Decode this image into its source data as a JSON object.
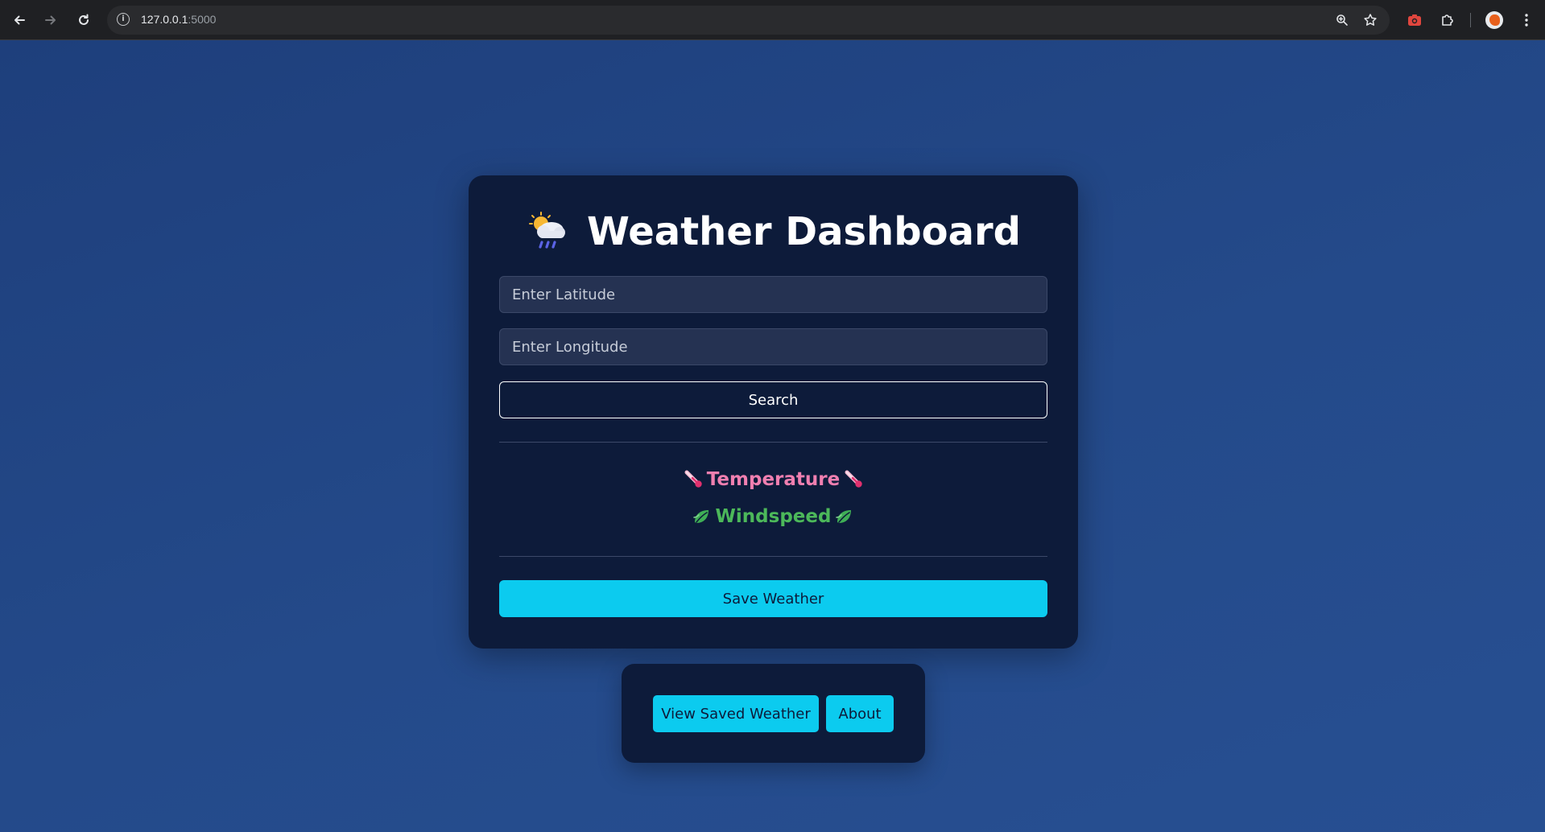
{
  "browser": {
    "url_host": "127.0.0.1",
    "url_port": ":5000",
    "icons": {
      "back": "arrow-left-icon",
      "forward": "arrow-right-icon",
      "reload": "reload-icon",
      "site_info": "info-icon",
      "zoom": "zoom-icon",
      "bookmark": "star-icon",
      "screenshot_ext": "camera-icon",
      "extensions": "puzzle-icon",
      "profile": "avatar",
      "menu": "kebab-menu-icon"
    }
  },
  "dashboard": {
    "title": "Weather Dashboard",
    "title_icon": "cloud-sun-rain-icon",
    "latitude_placeholder": "Enter Latitude",
    "latitude_value": "",
    "longitude_placeholder": "Enter Longitude",
    "longitude_value": "",
    "search_label": "Search",
    "temperature_label": "Temperature",
    "temperature_icon": "thermometer-icon",
    "windspeed_label": "Windspeed",
    "windspeed_icon": "leaf-wind-icon",
    "save_label": "Save Weather"
  },
  "nav": {
    "view_saved_label": "View Saved Weather",
    "about_label": "About"
  },
  "colors": {
    "page_background": "#244a8a",
    "card_background": "#0d1b3a",
    "accent": "#0ccbef",
    "temperature_text": "#f07fb0",
    "windspeed_text": "#4cb85a"
  }
}
